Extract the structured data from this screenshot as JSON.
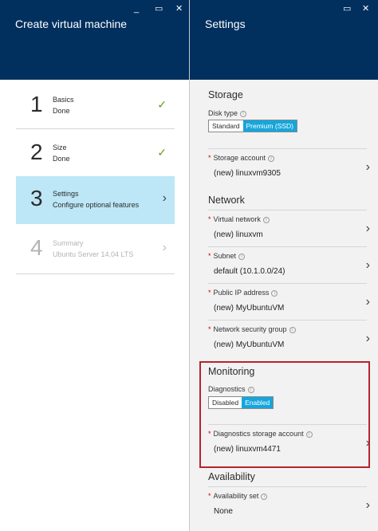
{
  "left_blade": {
    "title": "Create virtual machine",
    "controls": {
      "minimize": "_",
      "maximize": "▭",
      "close": "✕"
    },
    "steps": [
      {
        "number": "1",
        "label": "Basics",
        "sub": "Done",
        "status": "done",
        "icon": "check-icon"
      },
      {
        "number": "2",
        "label": "Size",
        "sub": "Done",
        "status": "done",
        "icon": "check-icon"
      },
      {
        "number": "3",
        "label": "Settings",
        "sub": "Configure optional features",
        "status": "active",
        "icon": "chevron-right-icon"
      },
      {
        "number": "4",
        "label": "Summary",
        "sub": "Ubuntu Server 14.04 LTS",
        "status": "disabled",
        "icon": "chevron-right-icon"
      }
    ]
  },
  "right_blade": {
    "title": "Settings",
    "controls": {
      "maximize": "▭",
      "close": "✕"
    },
    "storage": {
      "title": "Storage",
      "disk_type_label": "Disk type",
      "disk_type_options": [
        "Standard",
        "Premium (SSD)"
      ],
      "disk_type_selected": "Premium (SSD)",
      "storage_account_label": "Storage account",
      "storage_account_value": "(new) linuxvm9305"
    },
    "network": {
      "title": "Network",
      "virtual_network_label": "Virtual network",
      "virtual_network_value": "(new) linuxvm",
      "subnet_label": "Subnet",
      "subnet_value": "default (10.1.0.0/24)",
      "public_ip_label": "Public IP address",
      "public_ip_value": "(new) MyUbuntuVM",
      "nsg_label": "Network security group",
      "nsg_value": "(new) MyUbuntuVM"
    },
    "monitoring": {
      "title": "Monitoring",
      "diagnostics_label": "Diagnostics",
      "diagnostics_options": [
        "Disabled",
        "Enabled"
      ],
      "diagnostics_selected": "Enabled",
      "diag_storage_label": "Diagnostics storage account",
      "diag_storage_value": "(new) linuxvm4471"
    },
    "availability": {
      "title": "Availability",
      "availability_set_label": "Availability set",
      "availability_set_value": "None"
    }
  },
  "colors": {
    "header": "#01305f",
    "accent": "#15a6dc",
    "active_step": "#bde7f6",
    "check": "#6b9a1a",
    "highlight": "#b5252c"
  }
}
